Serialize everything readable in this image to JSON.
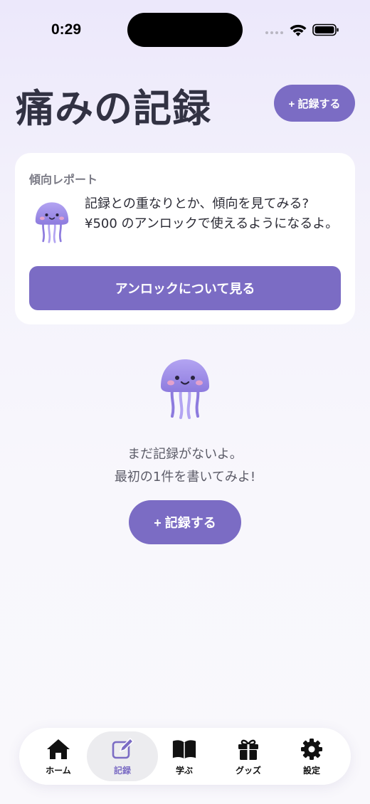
{
  "status_bar": {
    "time": "0:29"
  },
  "header": {
    "title": "痛みの記録",
    "add_button_label": "+ 記録する"
  },
  "report_card": {
    "label": "傾向レポート",
    "message": "記録との重なりとか、傾向を見てみる? ¥500 のアンロックで使えるようになるよ。",
    "unlock_button_label": "アンロックについて見る"
  },
  "empty_state": {
    "line1": "まだ記録がないよ。",
    "line2": "最初の1件を書いてみよ!",
    "add_button_label": "+ 記録する"
  },
  "tab_bar": {
    "tabs": [
      {
        "label": "ホーム",
        "icon": "home-icon",
        "active": false
      },
      {
        "label": "記録",
        "icon": "edit-icon",
        "active": true
      },
      {
        "label": "学ぶ",
        "icon": "book-icon",
        "active": false
      },
      {
        "label": "グッズ",
        "icon": "gift-icon",
        "active": false
      },
      {
        "label": "設定",
        "icon": "gear-icon",
        "active": false
      }
    ]
  },
  "colors": {
    "accent": "#7b6cc4",
    "title": "#323243",
    "jellyfish": "#a08ee8"
  }
}
